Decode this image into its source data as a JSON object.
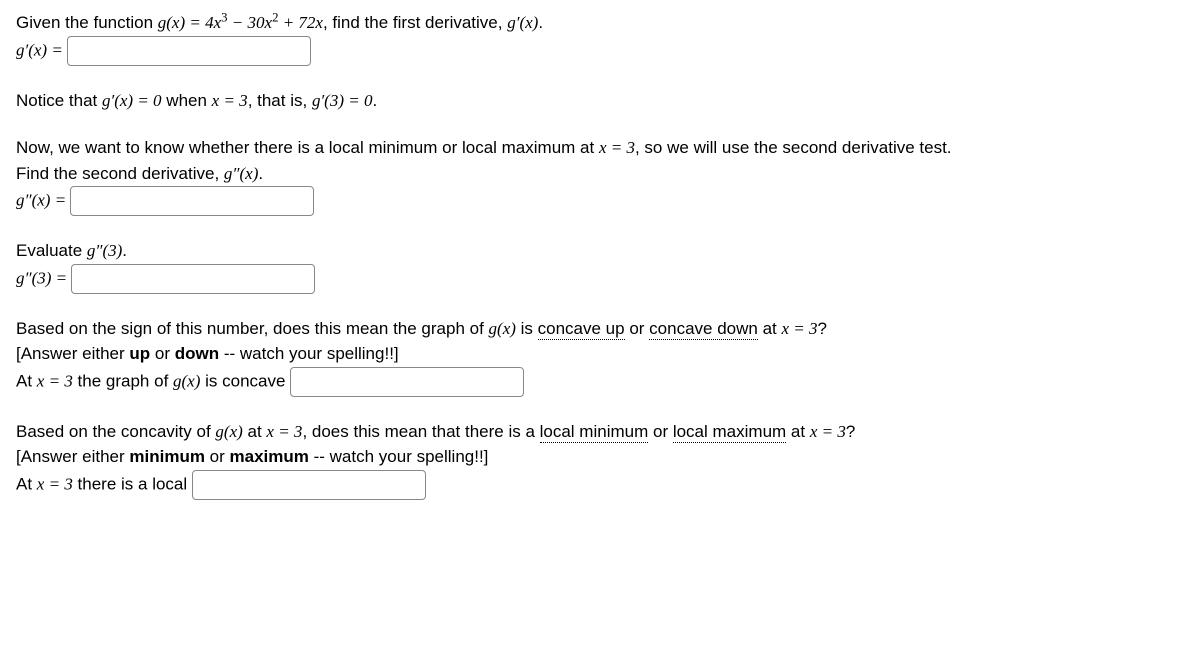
{
  "q1": {
    "prefix": "Given the function ",
    "func": "g(x) = 4x",
    "exp1": "3",
    "mid1": " − 30x",
    "exp2": "2",
    "mid2": " + 72x",
    "suffix": ", find the first derivative, ",
    "deriv": "g′(x)",
    "period": ".",
    "label": "g′(x) = "
  },
  "notice": {
    "p1": "Notice that ",
    "p2": "g′(x) = 0",
    "p3": " when ",
    "p4": "x = 3",
    "p5": ", that is, ",
    "p6": "g′(3) = 0",
    "p7": "."
  },
  "q2": {
    "line1a": "Now, we want to know whether there is a local minimum or local maximum at ",
    "line1b": "x = 3",
    "line1c": ", so we will use the second derivative test.",
    "line2a": "Find the second derivative, ",
    "line2b": "g″(x)",
    "line2c": ".",
    "label": "g″(x) = "
  },
  "q3": {
    "line1a": "Evaluate ",
    "line1b": "g″(3)",
    "line1c": ".",
    "label": "g″(3) = "
  },
  "q4": {
    "line1a": "Based on the sign of this number, does this mean the graph of ",
    "line1b": "g(x)",
    "line1c": " is ",
    "cu": "concave up",
    "line1d": " or ",
    "cd": "concave down",
    "line1e": " at ",
    "line1f": "x = 3",
    "line1g": "?",
    "hint1": "[Answer either ",
    "hint2": "up",
    "hint3": " or ",
    "hint4": "down",
    "hint5": " -- watch your spelling!!]",
    "ans1": "At ",
    "ans2": "x = 3",
    "ans3": " the graph of ",
    "ans4": "g(x)",
    "ans5": " is concave "
  },
  "q5": {
    "line1a": "Based on the concavity of ",
    "line1b": "g(x)",
    "line1c": " at ",
    "line1d": "x = 3",
    "line1e": ", does this mean that there is a ",
    "lm": "local minimum",
    "line1f": " or ",
    "lx": "local maximum",
    "line1g": " at ",
    "line1h": "x = 3",
    "line1i": "?",
    "hint1": "[Answer either ",
    "hint2": "minimum",
    "hint3": " or ",
    "hint4": "maximum",
    "hint5": " -- watch your spelling!!]",
    "ans1": "At ",
    "ans2": "x = 3",
    "ans3": " there is a local "
  }
}
